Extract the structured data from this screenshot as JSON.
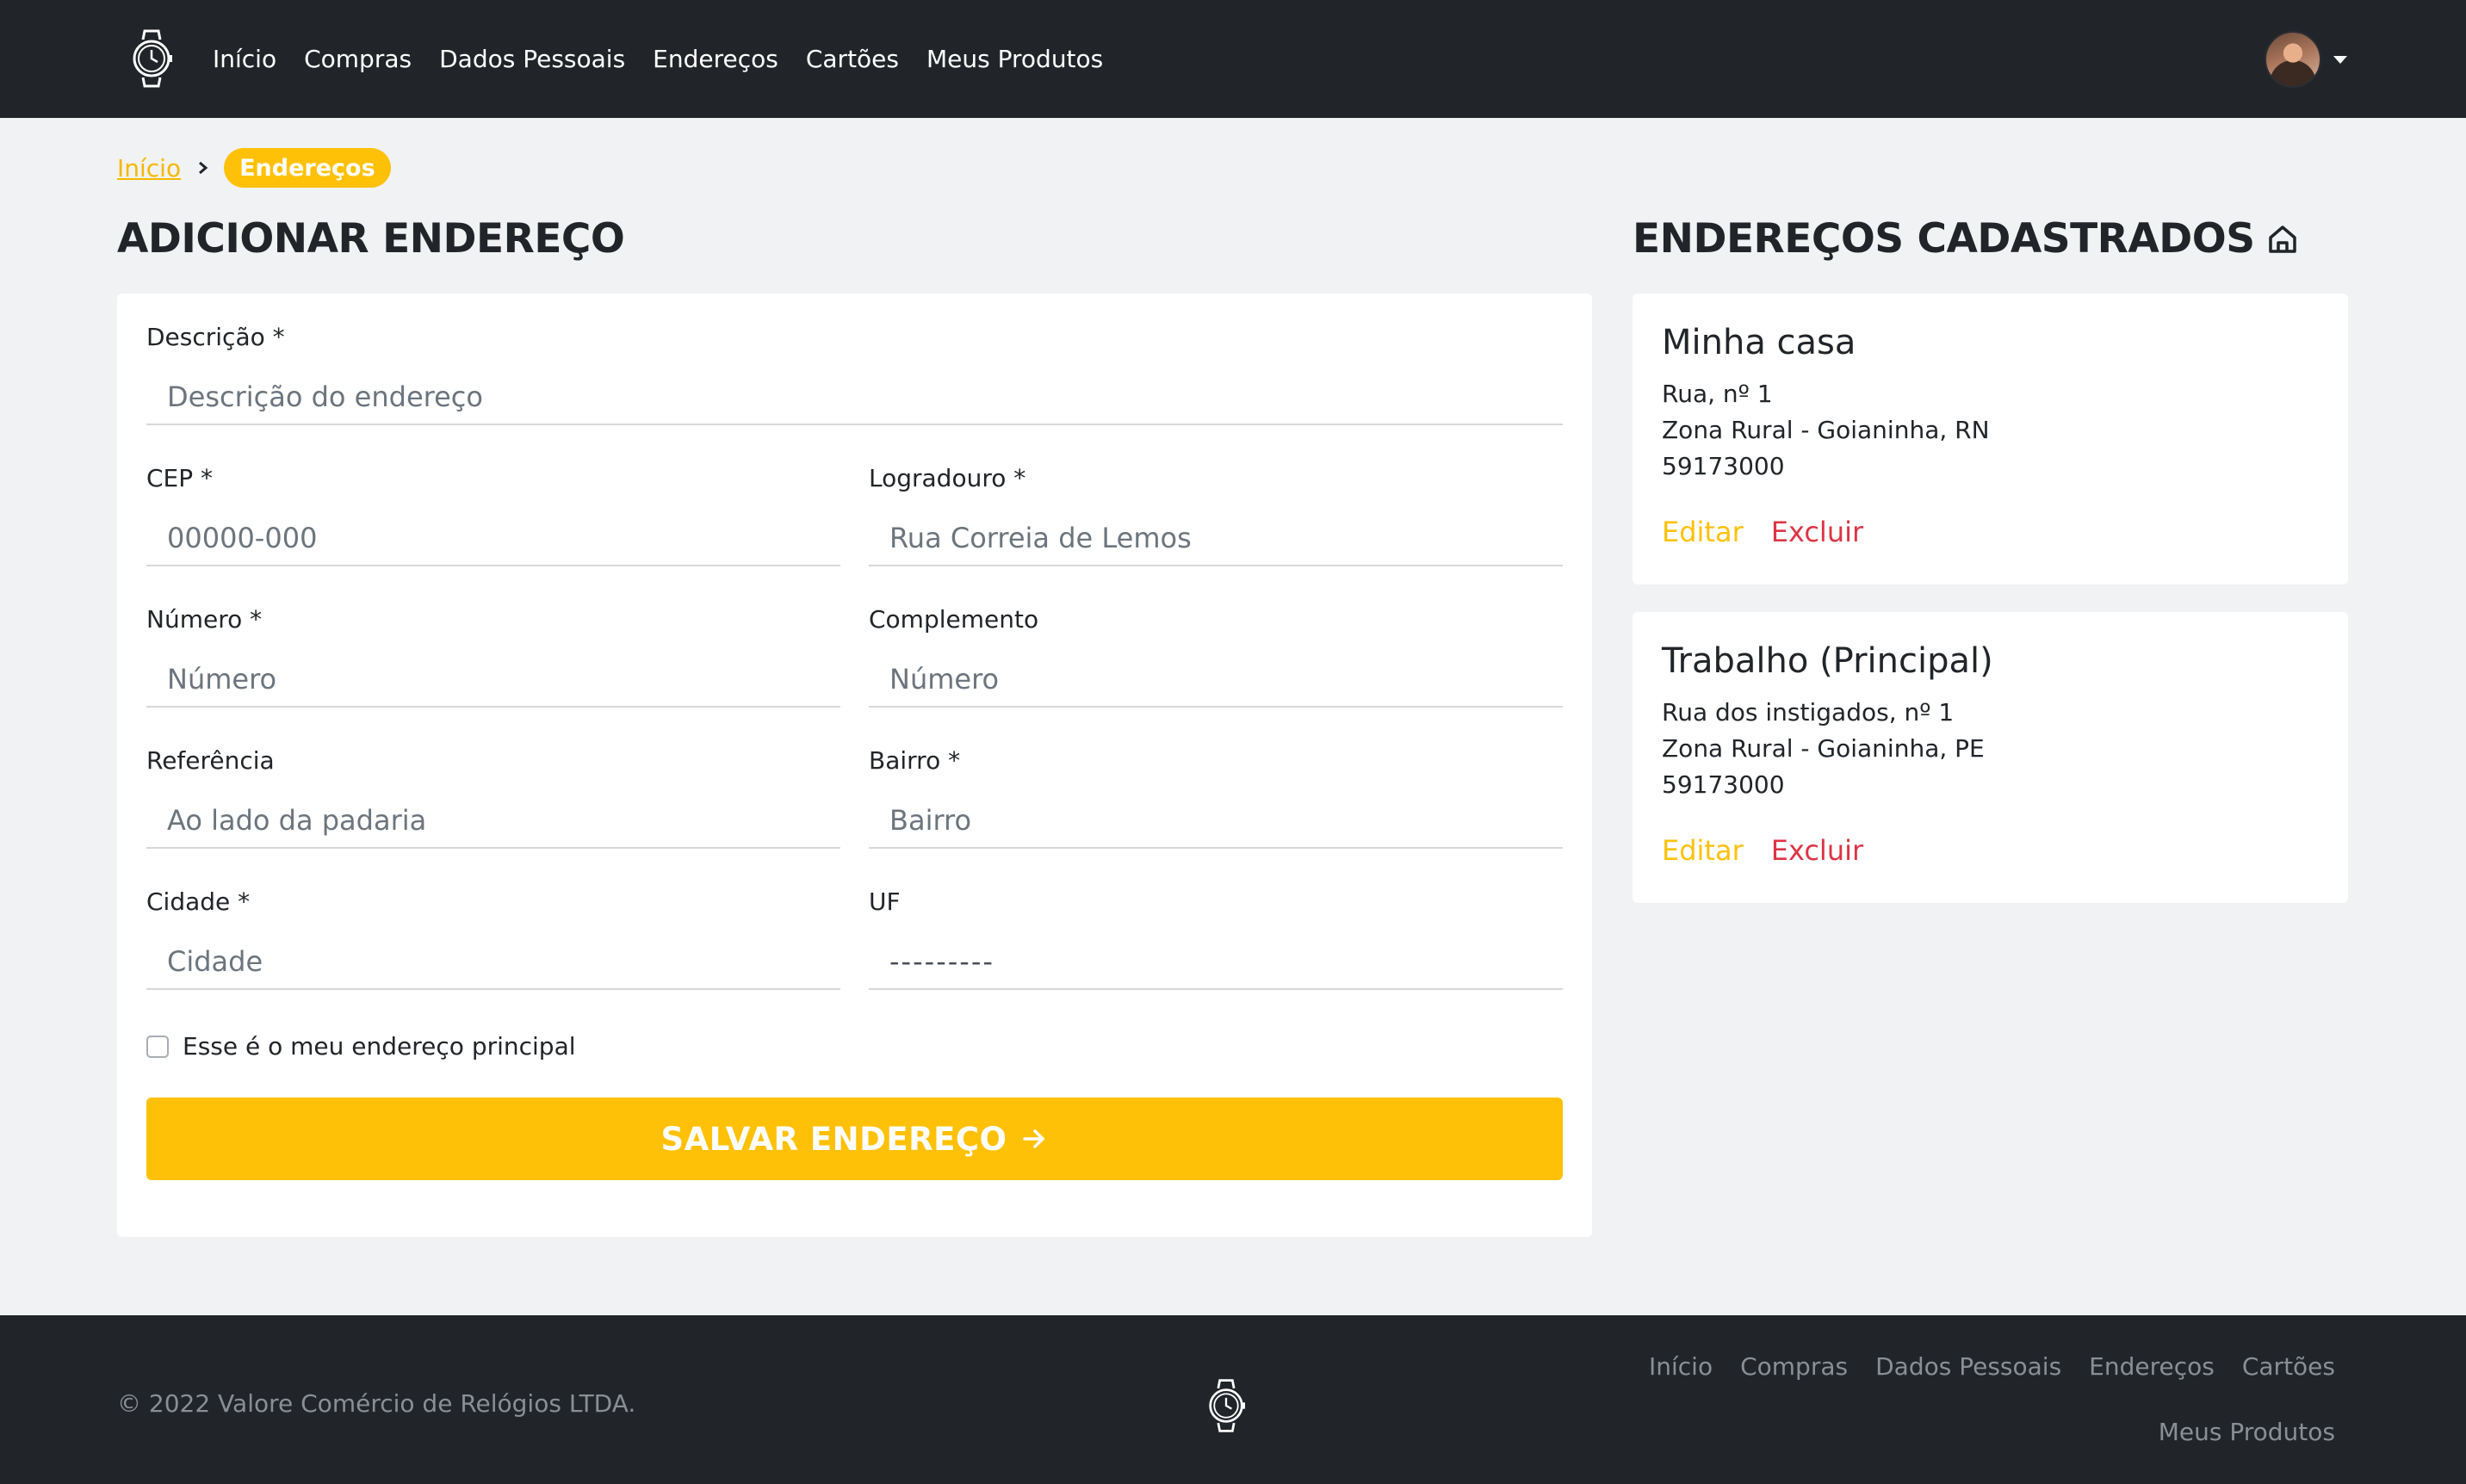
{
  "navbar": {
    "logo_icon": "wristwatch-icon",
    "links": [
      "Início",
      "Compras",
      "Dados Pessoais",
      "Endereços",
      "Cartões",
      "Meus Produtos"
    ],
    "user_menu_icon": "caret-down-icon"
  },
  "breadcrumb": {
    "home": "Início",
    "current": "Endereços"
  },
  "form": {
    "heading": "ADICIONAR ENDEREÇO",
    "descricao": {
      "label": "Descrição *",
      "placeholder": "Descrição do endereço"
    },
    "cep": {
      "label": "CEP *",
      "placeholder": "00000-000"
    },
    "logradouro": {
      "label": "Logradouro *",
      "placeholder": "Rua Correia de Lemos"
    },
    "numero": {
      "label": "Número *",
      "placeholder": "Número"
    },
    "complemento": {
      "label": "Complemento",
      "placeholder": "Número"
    },
    "referencia": {
      "label": "Referência",
      "placeholder": "Ao lado da padaria"
    },
    "bairro": {
      "label": "Bairro *",
      "placeholder": "Bairro"
    },
    "cidade": {
      "label": "Cidade *",
      "placeholder": "Cidade"
    },
    "uf": {
      "label": "UF",
      "value": "---------"
    },
    "principal_checkbox": {
      "label": "Esse é o meu endereço principal",
      "checked": false
    },
    "save_label": "SALVAR ENDEREÇO"
  },
  "addresses": {
    "heading": "ENDEREÇOS CADASTRADOS",
    "items": [
      {
        "title": "Minha casa",
        "street": "Rua, nº 1",
        "area": "Zona Rural - Goianinha, RN",
        "cep": "59173000",
        "edit": "Editar",
        "delete": "Excluir"
      },
      {
        "title": "Trabalho (Principal)",
        "street": "Rua dos instigados, nº 1",
        "area": "Zona Rural - Goianinha, PE",
        "cep": "59173000",
        "edit": "Editar",
        "delete": "Excluir"
      }
    ]
  },
  "footer": {
    "copyright": "© 2022 Valore Comércio de Relógios LTDA.",
    "links": [
      "Início",
      "Compras",
      "Dados Pessoais",
      "Endereços",
      "Cartões",
      "Meus Produtos"
    ]
  },
  "colors": {
    "accent": "#ffc107",
    "danger": "#dc3545",
    "dark": "#212529",
    "background": "#f1f2f3"
  }
}
